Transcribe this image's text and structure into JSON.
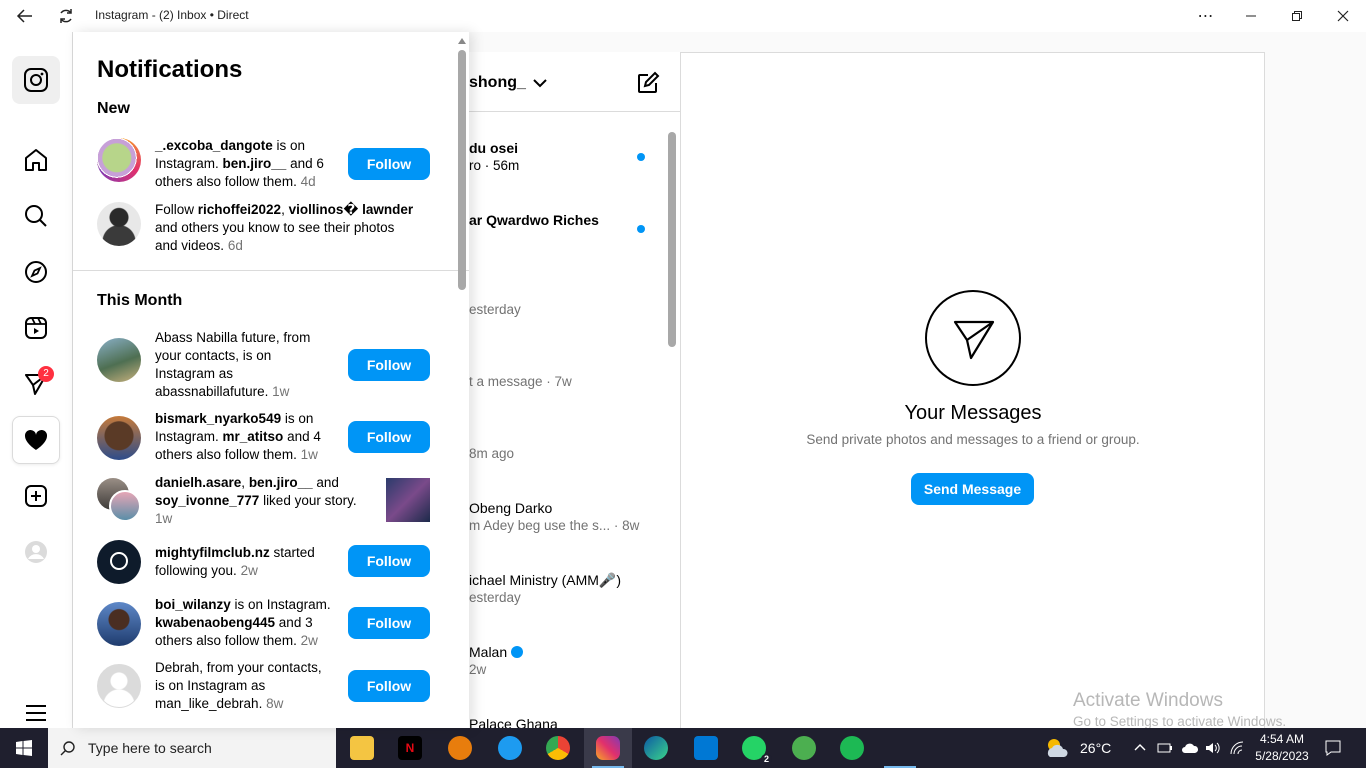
{
  "window": {
    "title": "Instagram - (2) Inbox • Direct",
    "back_icon": "arrow-left-icon",
    "refresh_icon": "refresh-icon"
  },
  "rail": {
    "messages_badge": "2"
  },
  "notifications": {
    "title": "Notifications",
    "section_new": "New",
    "section_month": "This Month",
    "follow_label": "Follow",
    "items": [
      {
        "parts": [
          [
            "b",
            "_.excoba_dangote"
          ],
          [
            "t",
            " is on Instagram. "
          ],
          [
            "b",
            "ben.jiro__"
          ],
          [
            "t",
            " and 6 others also follow them. "
          ],
          [
            "m",
            "4d"
          ]
        ],
        "follow": true
      },
      {
        "parts": [
          [
            "t",
            "Follow "
          ],
          [
            "b",
            "richoffei2022"
          ],
          [
            "t",
            ", "
          ],
          [
            "b",
            "viollinos� lawnder"
          ],
          [
            "t",
            " and others you know to see their photos and videos. "
          ],
          [
            "m",
            "6d"
          ]
        ],
        "follow": false
      },
      {
        "parts": [
          [
            "t",
            "Abass Nabilla future, from your contacts, is on Instagram as abassnabillafuture. "
          ],
          [
            "m",
            "1w"
          ]
        ],
        "follow": true
      },
      {
        "parts": [
          [
            "b",
            "bismark_nyarko549"
          ],
          [
            "t",
            " is on Instagram. "
          ],
          [
            "b",
            "mr_atitso"
          ],
          [
            "t",
            " and 4 others also follow them. "
          ],
          [
            "m",
            "1w"
          ]
        ],
        "follow": true
      },
      {
        "parts": [
          [
            "b",
            "danielh.asare"
          ],
          [
            "t",
            ", "
          ],
          [
            "b",
            "ben.jiro__"
          ],
          [
            "t",
            " and "
          ],
          [
            "b",
            "soy_ivonne_777"
          ],
          [
            "t",
            " liked your story. "
          ],
          [
            "m",
            "1w"
          ]
        ],
        "follow": false
      },
      {
        "parts": [
          [
            "b",
            "mightyfilmclub.nz"
          ],
          [
            "t",
            " started following you. "
          ],
          [
            "m",
            "2w"
          ]
        ],
        "follow": true
      },
      {
        "parts": [
          [
            "b",
            "boi_wilanzy"
          ],
          [
            "t",
            " is on Instagram. "
          ],
          [
            "b",
            "kwabenaobeng445"
          ],
          [
            "t",
            " and 3 others also follow them. "
          ],
          [
            "m",
            "2w"
          ]
        ],
        "follow": true
      },
      {
        "parts": [
          [
            "t",
            "Debrah, from your contacts, is on Instagram as man_like_debrah. "
          ],
          [
            "m",
            "8w"
          ]
        ],
        "follow": true
      }
    ]
  },
  "inbox": {
    "username": "shong_",
    "conversations": [
      {
        "name": "du osei",
        "sub": "ro · 56m",
        "bold": true,
        "unread": true
      },
      {
        "name": "ar Qwardwo Riches",
        "sub": "",
        "bold": true,
        "unread": true
      },
      {
        "name": "",
        "sub": "esterday",
        "bold": false,
        "unread": false
      },
      {
        "name": "",
        "sub": "t a message · 7w",
        "bold": false,
        "unread": false
      },
      {
        "name": "",
        "sub": "8m ago",
        "bold": false,
        "unread": false
      },
      {
        "name": "Obeng Darko",
        "sub": "m Adey beg use the s...  · 8w",
        "bold": false,
        "unread": false
      },
      {
        "name": "ichael Ministry (AMM🎤)",
        "sub": "esterday",
        "bold": false,
        "unread": false
      },
      {
        "name": "Malan",
        "sub": "2w",
        "bold": false,
        "unread": false,
        "verified": true
      },
      {
        "name": "Palace Ghana",
        "sub": "",
        "bold": false,
        "unread": false
      }
    ]
  },
  "main": {
    "title": "Your Messages",
    "subtitle": "Send private photos and messages to a friend or group.",
    "button": "Send Message"
  },
  "watermark": {
    "title": "Activate Windows",
    "subtitle": "Go to Settings to activate Windows."
  },
  "taskbar": {
    "search_placeholder": "Type here to search",
    "temperature": "26°C",
    "time": "4:54 AM",
    "date": "5/28/2023",
    "whatsapp_badge": "2"
  }
}
